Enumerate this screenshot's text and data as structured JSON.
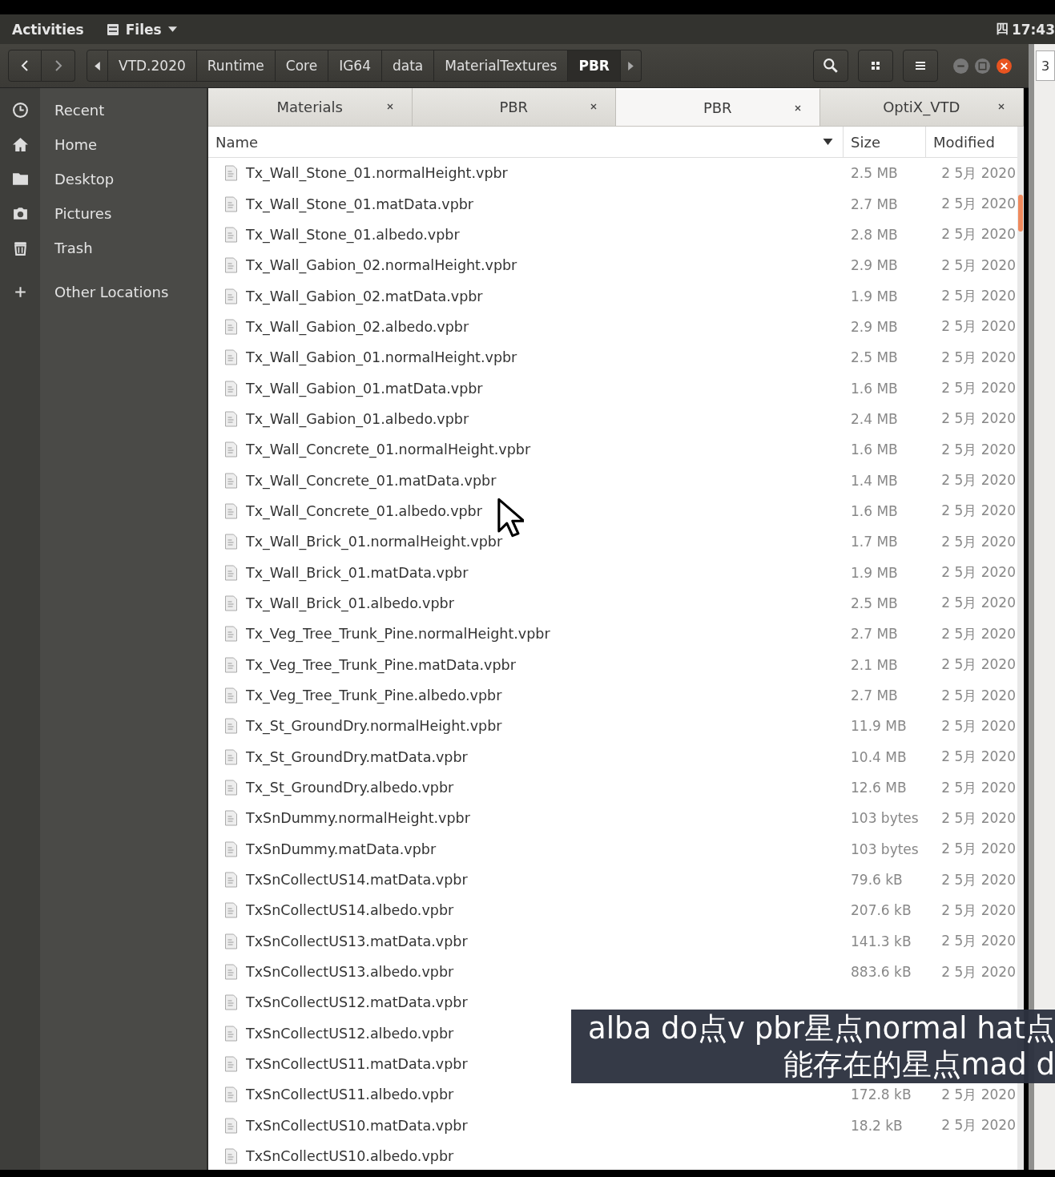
{
  "top_bar": {
    "activities": "Activities",
    "app_menu": "Files",
    "input_indicator": "四",
    "clock": "17:43"
  },
  "header_bar": {
    "path": [
      {
        "label": "VTD.2020",
        "selected": false
      },
      {
        "label": "Runtime",
        "selected": false
      },
      {
        "label": "Core",
        "selected": false
      },
      {
        "label": "IG64",
        "selected": false
      },
      {
        "label": "data",
        "selected": false
      },
      {
        "label": "MaterialTextures",
        "selected": false
      },
      {
        "label": "PBR",
        "selected": true
      }
    ]
  },
  "sidebar": {
    "items": [
      {
        "label": "Recent",
        "kind": "recent"
      },
      {
        "label": "Home",
        "kind": "home"
      },
      {
        "label": "Desktop",
        "kind": "desktop"
      },
      {
        "label": "Pictures",
        "kind": "pictures"
      },
      {
        "label": "Trash",
        "kind": "trash"
      },
      {
        "label": "Other Locations",
        "kind": "other"
      }
    ]
  },
  "tabs": [
    {
      "label": "Materials",
      "selected": false
    },
    {
      "label": "PBR",
      "selected": false
    },
    {
      "label": "PBR",
      "selected": true
    },
    {
      "label": "OptiX_VTD",
      "selected": false
    }
  ],
  "columns": [
    "Name",
    "Size",
    "Modified"
  ],
  "rows": [
    {
      "name": "Tx_Wall_Stone_01.normalHeight.vpbr",
      "size": "2.5 MB",
      "modified": "2 5月 2020"
    },
    {
      "name": "Tx_Wall_Stone_01.matData.vpbr",
      "size": "2.7 MB",
      "modified": "2 5月 2020"
    },
    {
      "name": "Tx_Wall_Stone_01.albedo.vpbr",
      "size": "2.8 MB",
      "modified": "2 5月 2020"
    },
    {
      "name": "Tx_Wall_Gabion_02.normalHeight.vpbr",
      "size": "2.9 MB",
      "modified": "2 5月 2020"
    },
    {
      "name": "Tx_Wall_Gabion_02.matData.vpbr",
      "size": "1.9 MB",
      "modified": "2 5月 2020"
    },
    {
      "name": "Tx_Wall_Gabion_02.albedo.vpbr",
      "size": "2.9 MB",
      "modified": "2 5月 2020"
    },
    {
      "name": "Tx_Wall_Gabion_01.normalHeight.vpbr",
      "size": "2.5 MB",
      "modified": "2 5月 2020"
    },
    {
      "name": "Tx_Wall_Gabion_01.matData.vpbr",
      "size": "1.6 MB",
      "modified": "2 5月 2020"
    },
    {
      "name": "Tx_Wall_Gabion_01.albedo.vpbr",
      "size": "2.4 MB",
      "modified": "2 5月 2020"
    },
    {
      "name": "Tx_Wall_Concrete_01.normalHeight.vpbr",
      "size": "1.6 MB",
      "modified": "2 5月 2020"
    },
    {
      "name": "Tx_Wall_Concrete_01.matData.vpbr",
      "size": "1.4 MB",
      "modified": "2 5月 2020"
    },
    {
      "name": "Tx_Wall_Concrete_01.albedo.vpbr",
      "size": "1.6 MB",
      "modified": "2 5月 2020"
    },
    {
      "name": "Tx_Wall_Brick_01.normalHeight.vpbr",
      "size": "1.7 MB",
      "modified": "2 5月 2020"
    },
    {
      "name": "Tx_Wall_Brick_01.matData.vpbr",
      "size": "1.9 MB",
      "modified": "2 5月 2020"
    },
    {
      "name": "Tx_Wall_Brick_01.albedo.vpbr",
      "size": "2.5 MB",
      "modified": "2 5月 2020"
    },
    {
      "name": "Tx_Veg_Tree_Trunk_Pine.normalHeight.vpbr",
      "size": "2.7 MB",
      "modified": "2 5月 2020"
    },
    {
      "name": "Tx_Veg_Tree_Trunk_Pine.matData.vpbr",
      "size": "2.1 MB",
      "modified": "2 5月 2020"
    },
    {
      "name": "Tx_Veg_Tree_Trunk_Pine.albedo.vpbr",
      "size": "2.7 MB",
      "modified": "2 5月 2020"
    },
    {
      "name": "Tx_St_GroundDry.normalHeight.vpbr",
      "size": "11.9 MB",
      "modified": "2 5月 2020"
    },
    {
      "name": "Tx_St_GroundDry.matData.vpbr",
      "size": "10.4 MB",
      "modified": "2 5月 2020"
    },
    {
      "name": "Tx_St_GroundDry.albedo.vpbr",
      "size": "12.6 MB",
      "modified": "2 5月 2020"
    },
    {
      "name": "TxSnDummy.normalHeight.vpbr",
      "size": "103 bytes",
      "modified": "2 5月 2020"
    },
    {
      "name": "TxSnDummy.matData.vpbr",
      "size": "103 bytes",
      "modified": "2 5月 2020"
    },
    {
      "name": "TxSnCollectUS14.matData.vpbr",
      "size": "79.6 kB",
      "modified": "2 5月 2020"
    },
    {
      "name": "TxSnCollectUS14.albedo.vpbr",
      "size": "207.6 kB",
      "modified": "2 5月 2020"
    },
    {
      "name": "TxSnCollectUS13.matData.vpbr",
      "size": "141.3 kB",
      "modified": "2 5月 2020"
    },
    {
      "name": "TxSnCollectUS13.albedo.vpbr",
      "size": "883.6 kB",
      "modified": "2 5月 2020"
    },
    {
      "name": "TxSnCollectUS12.matData.vpbr"
    },
    {
      "name": "TxSnCollectUS12.albedo.vpbr"
    },
    {
      "name": "TxSnCollectUS11.matData.vpbr"
    },
    {
      "name": "TxSnCollectUS11.albedo.vpbr",
      "size": "172.8 kB",
      "modified": "2 5月 2020"
    },
    {
      "name": "TxSnCollectUS10.matData.vpbr",
      "size": "18.2 kB",
      "modified": "2 5月 2020"
    },
    {
      "name": "TxSnCollectUS10.albedo.vpbr"
    }
  ],
  "other_window": {
    "label": "3"
  },
  "subtitle": [
    "alba do点v pbr星点normal hat点",
    "能存在的星点mad d"
  ]
}
